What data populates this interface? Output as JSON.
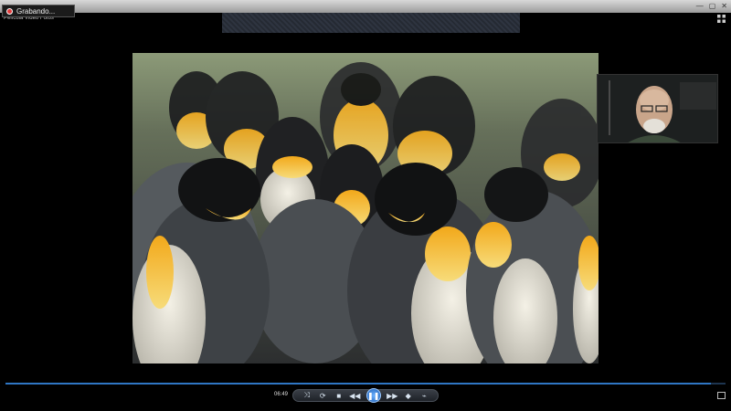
{
  "recording_badge": {
    "label": "Grabando..."
  },
  "app_title": "Película Video Fotos",
  "player": {
    "time": "06:49",
    "progress_percent": 98
  },
  "icons": [
    "record-dot-icon",
    "grid-view-icon",
    "shuffle-icon",
    "repeat-icon",
    "stop-icon",
    "previous-icon",
    "pause-icon",
    "next-icon",
    "volume-icon",
    "volume-slider-icon",
    "fullscreen-icon"
  ],
  "colors": {
    "accent": "#2f76c4",
    "record": "#e23b3b"
  }
}
